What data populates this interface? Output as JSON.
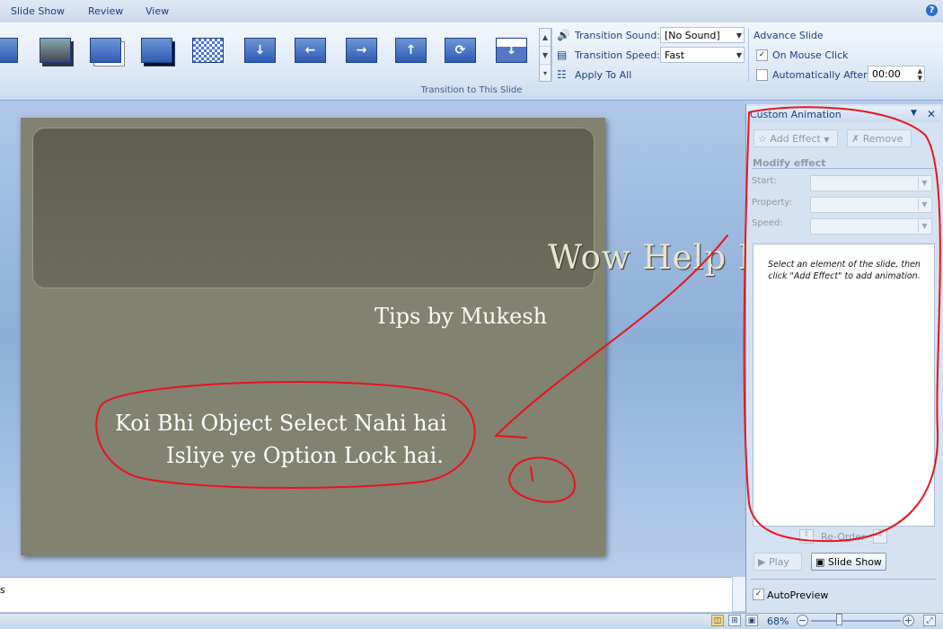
{
  "ribbon": {
    "tabs": [
      "Slide Show",
      "Review",
      "View"
    ],
    "help_icon": "?",
    "transition_gallery": [
      "push-down",
      "push-left",
      "push-right",
      "push-up",
      "wheel",
      "wipe-down"
    ],
    "transition_sound": {
      "label": "Transition Sound:",
      "value": "[No Sound]"
    },
    "transition_speed": {
      "label": "Transition Speed:",
      "value": "Fast"
    },
    "apply_to_all": "Apply To All",
    "group_label": "Transition to This Slide",
    "advance_slide": {
      "title": "Advance Slide",
      "on_mouse_click": "On Mouse Click",
      "on_mouse_click_checked": true,
      "automatically_after": "Automatically After:",
      "automatically_after_checked": false,
      "time": "00:00"
    }
  },
  "slide": {
    "title": "Wow Help Hindi me",
    "subtitle": "Tips by Mukesh",
    "annotation_line1": "Koi Bhi Object Select Nahi hai",
    "annotation_line2": "Isliye ye Option Lock hai."
  },
  "notes": {
    "text": "s"
  },
  "task_pane": {
    "title": "Custom Animation",
    "add_effect": "Add Effect",
    "remove": "Remove",
    "modify_effect": "Modify effect",
    "start_label": "Start:",
    "property_label": "Property:",
    "speed_label": "Speed:",
    "hint": "Select an element of the slide, then click \"Add Effect\" to add animation.",
    "reorder": "Re-Order",
    "play": "Play",
    "slide_show": "Slide Show",
    "autopreview": "AutoPreview",
    "autopreview_checked": true
  },
  "status_bar": {
    "zoom": "68%"
  },
  "colors": {
    "annotation": "#e8141c",
    "slide_bg": "#828270"
  }
}
